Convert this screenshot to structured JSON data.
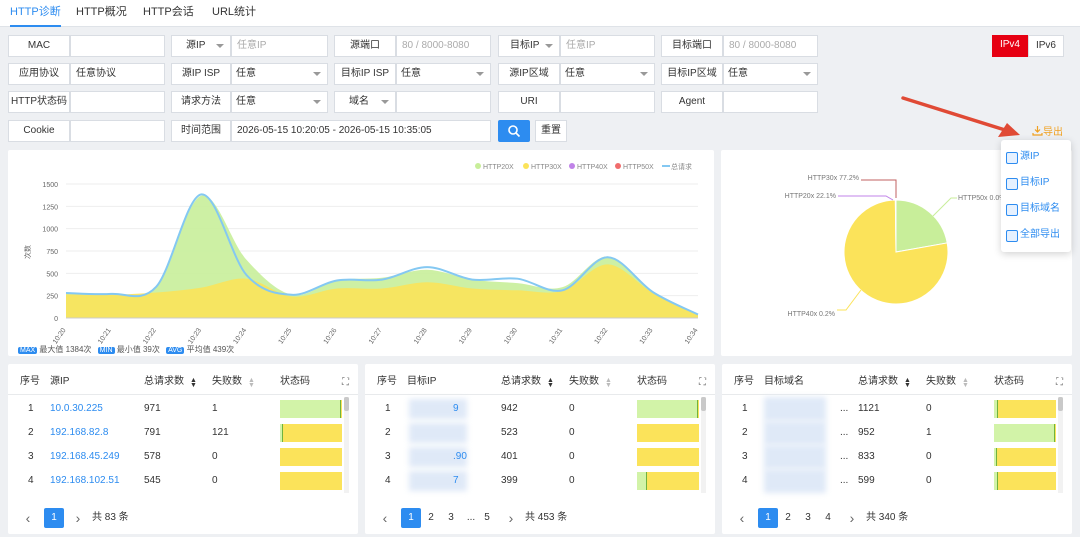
{
  "tabs": [
    "HTTP诊断",
    "HTTP概况",
    "HTTP会话",
    "URL统计"
  ],
  "filters": {
    "mac": "MAC",
    "src_ip": "源IP",
    "src_ip_ph": "任意IP",
    "src_port": "源端口",
    "src_port_ph": "80 / 8000-8080",
    "dst_ip": "目标IP",
    "dst_ip_ph": "任意IP",
    "dst_port": "目标端口",
    "dst_port_ph": "80 / 8000-8080",
    "app_proto": "应用协议",
    "app_proto_val": "任意协议",
    "src_isp": "源IP ISP",
    "src_isp_val": "任意",
    "dst_isp": "目标IP ISP",
    "dst_isp_val": "任意",
    "src_region": "源IP区域",
    "src_region_val": "任意",
    "dst_region": "目标IP区域",
    "dst_region_val": "任意",
    "status": "HTTP状态码",
    "method": "请求方法",
    "method_val": "任意",
    "domain": "域名",
    "uri": "URI",
    "agent": "Agent",
    "cookie": "Cookie",
    "time_range": "时间范围",
    "time_val": "2026-05-15 10:20:05 - 2026-05-15 10:35:05",
    "reset": "重置"
  },
  "ip_toggle": {
    "v4": "IPv4",
    "v6": "IPv6"
  },
  "export": {
    "label": "导出",
    "items": [
      "源IP",
      "目标IP",
      "目标域名",
      "全部导出"
    ]
  },
  "line_chart": {
    "legend": [
      "HTTP20X",
      "HTTP30X",
      "HTTP40X",
      "HTTP50X",
      "总请求"
    ],
    "ylabel": "次数",
    "stats": [
      {
        "tag": "MAX",
        "text": "最大值 1384次"
      },
      {
        "tag": "MIN",
        "text": "最小值 39次"
      },
      {
        "tag": "AVG",
        "text": "平均值 439次"
      }
    ]
  },
  "pie_chart": {
    "labels": [
      "HTTP50x 0.0%",
      "HTTP40x 0.2%",
      "HTTP20x 22.1%",
      "HTTP30x 77.2%"
    ]
  },
  "colors": {
    "accent": "#2d8cf0",
    "red": "#e60012",
    "c20x": "#c8ee9a",
    "c30x": "#fbe35a",
    "c40x": "#c083e8",
    "c50x": "#f06c6c",
    "total": "#84c8f2"
  },
  "chart_data": [
    {
      "type": "area",
      "x": [
        "10:20",
        "10:21",
        "10:22",
        "10:23",
        "10:24",
        "10:25",
        "10:26",
        "10:27",
        "10:28",
        "10:29",
        "10:30",
        "10:31",
        "10:32",
        "10:33",
        "10:34"
      ],
      "ylim": [
        0,
        1500
      ],
      "yticks": [
        0,
        250,
        500,
        750,
        1000,
        1250,
        1500
      ],
      "ylabel": "次数",
      "series": [
        {
          "name": "HTTP20X",
          "values": [
            10,
            10,
            60,
            1030,
            210,
            20,
            90,
            120,
            140,
            100,
            80,
            40,
            90,
            10,
            5
          ]
        },
        {
          "name": "HTTP30X",
          "values": [
            265,
            260,
            285,
            340,
            440,
            240,
            330,
            330,
            400,
            330,
            310,
            305,
            600,
            280,
            34
          ]
        },
        {
          "name": "HTTP40X",
          "values": [
            0,
            0,
            0,
            0,
            0,
            0,
            0,
            0,
            0,
            0,
            0,
            0,
            0,
            0,
            0
          ]
        },
        {
          "name": "HTTP50X",
          "values": [
            0,
            0,
            0,
            0,
            0,
            0,
            0,
            0,
            0,
            0,
            0,
            0,
            0,
            0,
            0
          ]
        },
        {
          "name": "总请求",
          "values": [
            280,
            270,
            350,
            1384,
            480,
            260,
            420,
            430,
            570,
            430,
            440,
            310,
            680,
            290,
            39
          ]
        }
      ]
    },
    {
      "type": "pie",
      "categories": [
        "HTTP20x",
        "HTTP30x",
        "HTTP40x",
        "HTTP50x"
      ],
      "values": [
        22.1,
        77.2,
        0.2,
        0.0
      ]
    }
  ],
  "tables": [
    {
      "headers": [
        "序号",
        "源IP",
        "总请求数",
        "失败数",
        "状态码"
      ],
      "rows": [
        {
          "n": "1",
          "key": "10.0.30.225",
          "total": "971",
          "fail": "1",
          "g": 0.97
        },
        {
          "n": "2",
          "key": "192.168.82.8",
          "total": "791",
          "fail": "121",
          "g": 0.03
        },
        {
          "n": "3",
          "key": "192.168.45.249",
          "total": "578",
          "fail": "0",
          "g": 0
        },
        {
          "n": "4",
          "key": "192.168.102.51",
          "total": "545",
          "fail": "0",
          "g": 0
        }
      ],
      "pages": [
        "1"
      ],
      "total_text": "共 83 条"
    },
    {
      "headers": [
        "序号",
        "目标IP",
        "总请求数",
        "失败数",
        "状态码"
      ],
      "rows": [
        {
          "n": "1",
          "key": "9",
          "total": "942",
          "fail": "0",
          "g": 0.97
        },
        {
          "n": "2",
          "key": "",
          "total": "523",
          "fail": "0",
          "g": 0
        },
        {
          "n": "3",
          "key": ".90",
          "total": "401",
          "fail": "0",
          "g": 0
        },
        {
          "n": "4",
          "key": "7",
          "total": "399",
          "fail": "0",
          "g": 0.15
        }
      ],
      "pages": [
        "1",
        "2",
        "3",
        "...",
        "5"
      ],
      "total_text": "共 453 条"
    },
    {
      "headers": [
        "序号",
        "目标域名",
        "总请求数",
        "失败数",
        "状态码"
      ],
      "rows": [
        {
          "n": "1",
          "key": "...",
          "total": "1121",
          "fail": "0",
          "g": 0.05
        },
        {
          "n": "2",
          "key": "...",
          "total": "952",
          "fail": "1",
          "g": 0.97
        },
        {
          "n": "3",
          "key": "...",
          "total": "833",
          "fail": "0",
          "g": 0.03
        },
        {
          "n": "4",
          "key": "...",
          "total": "599",
          "fail": "0",
          "g": 0.05
        }
      ],
      "pages": [
        "1",
        "2",
        "3",
        "4"
      ],
      "total_text": "共 340 条"
    }
  ]
}
